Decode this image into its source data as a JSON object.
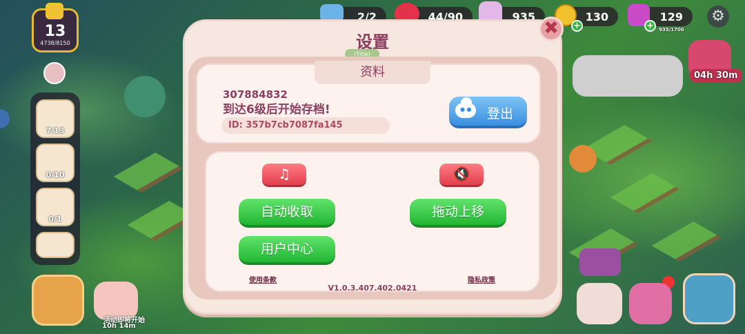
{
  "hud": {
    "level": "13",
    "xp": "4738/8150",
    "energy": "2/2",
    "hearts": "44/90",
    "potions": "935",
    "coins": "130",
    "gems": "129",
    "gems_cap": "935/1700",
    "plus": "+"
  },
  "sidebar": {
    "items": [
      {
        "count": "7/13"
      },
      {
        "count": "0/10"
      },
      {
        "count": "0/1"
      }
    ]
  },
  "event": {
    "label": "活动即将开始",
    "timer": "10h 14m"
  },
  "chest_timer": "04h 30m",
  "settings": {
    "title": "设置",
    "subtitle": "(Title)",
    "close_glyph": "✖",
    "profile_tab": "资料",
    "player_id": "307884832",
    "save_message": "到达6级后开始存档!",
    "device_id": "ID: 357b7cb7087fa145",
    "logout_label": "登出",
    "music_glyph": "♫",
    "sound_glyph": "🔇",
    "auto_collect": "自动收取",
    "drag_up": "拖动上移",
    "user_center": "用户中心",
    "terms": "使用条款",
    "privacy": "隐私政策",
    "version": "V1.0.3.407.402.0421"
  },
  "colors": {
    "accent": "#8b3e5f",
    "green_button": "#22b634",
    "red_toggle": "#e2404d",
    "blue_button": "#3b8fe0"
  }
}
